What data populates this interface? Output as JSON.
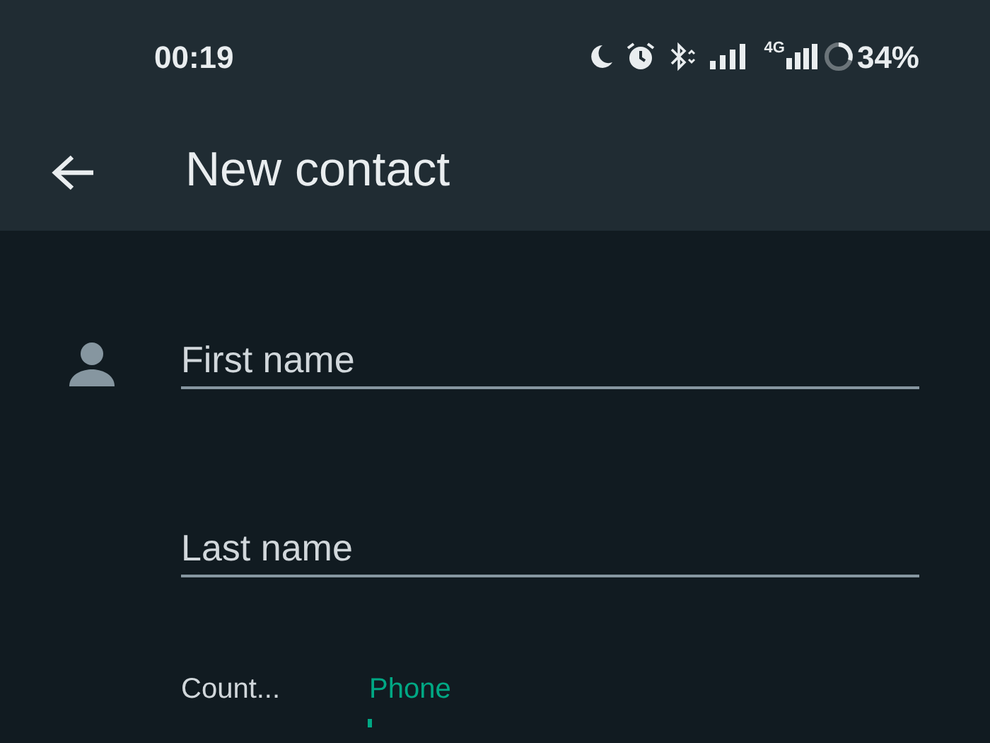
{
  "status_bar": {
    "time": "00:19",
    "network": "4G",
    "battery": "34%"
  },
  "app_bar": {
    "title": "New contact"
  },
  "fields": [
    {
      "placeholder": "First name"
    },
    {
      "placeholder": "Last name"
    }
  ],
  "country": {
    "label": "Count..."
  },
  "phone": {
    "label": "Phone",
    "focused": true
  }
}
